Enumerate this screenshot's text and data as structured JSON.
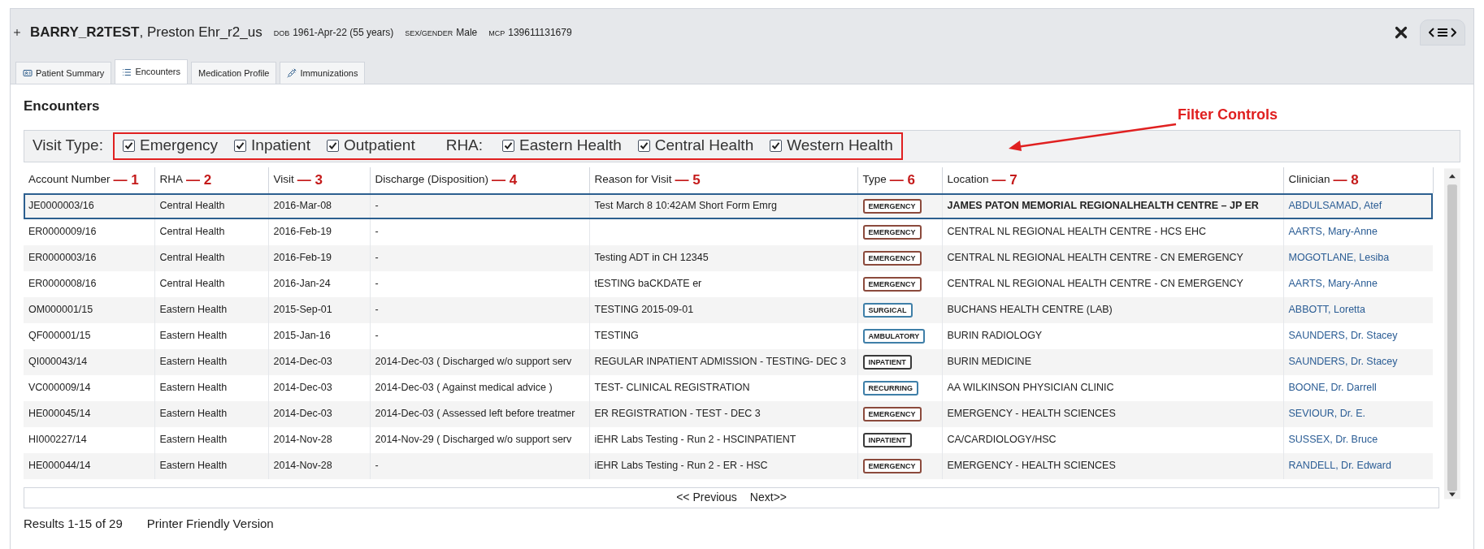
{
  "patient": {
    "name": "BARRY_R2TEST",
    "given": ", Preston Ehr_r2_us",
    "fields": [
      {
        "label": "DOB",
        "value": "1961-Apr-22 (55 years)"
      },
      {
        "label": "SEX/GENDER",
        "value": "Male"
      },
      {
        "label": "MCP",
        "value": "139611131679"
      }
    ]
  },
  "tabs": [
    {
      "label": "Patient Summary",
      "kind": "summary",
      "selected": false
    },
    {
      "label": "Encounters",
      "kind": "list",
      "selected": true
    },
    {
      "label": "Medication Profile",
      "kind": "none",
      "selected": false
    },
    {
      "label": "Immunizations",
      "kind": "syringe",
      "selected": false
    }
  ],
  "section_title": "Encounters",
  "filters": {
    "visit_type_label": "Visit Type:",
    "visit_types": [
      {
        "label": "Emergency",
        "checked": true
      },
      {
        "label": "Inpatient",
        "checked": true
      },
      {
        "label": "Outpatient",
        "checked": true
      }
    ],
    "rha_label": "RHA:",
    "rhas": [
      {
        "label": "Eastern Health",
        "checked": true
      },
      {
        "label": "Central Health",
        "checked": true
      },
      {
        "label": "Western Health",
        "checked": true
      }
    ]
  },
  "annotation": {
    "label": "Filter Controls"
  },
  "table": {
    "columns": [
      {
        "label": "Account Number",
        "marker": "— 1"
      },
      {
        "label": "RHA",
        "marker": "— 2"
      },
      {
        "label": "Visit",
        "marker": "— 3"
      },
      {
        "label": "Discharge (Disposition)",
        "marker": "— 4"
      },
      {
        "label": "Reason for Visit",
        "marker": "— 5"
      },
      {
        "label": "Type",
        "marker": "— 6"
      },
      {
        "label": "Location",
        "marker": "— 7"
      },
      {
        "label": "Clinician",
        "marker": "— 8"
      }
    ],
    "rows": [
      {
        "selected": true,
        "cells": [
          "JE0000003/16",
          "Central Health",
          "2016-Mar-08",
          "-",
          "Test March 8 10:42AM Short Form Emrg"
        ],
        "type": {
          "label": "EMERGENCY",
          "color": "#8b4a3c"
        },
        "location": "JAMES PATON MEMORIAL REGIONALHEALTH CENTRE – JP ER",
        "clinician": "ABDULSAMAD, Atef"
      },
      {
        "selected": false,
        "cells": [
          "ER0000009/16",
          "Central Health",
          "2016-Feb-19",
          "-",
          ""
        ],
        "type": {
          "label": "EMERGENCY",
          "color": "#8b4a3c"
        },
        "location": "CENTRAL NL REGIONAL HEALTH CENTRE - HCS EHC",
        "clinician": "AARTS, Mary-Anne"
      },
      {
        "selected": false,
        "cells": [
          "ER0000003/16",
          "Central Health",
          "2016-Feb-19",
          "-",
          "Testing ADT in CH 12345"
        ],
        "type": {
          "label": "EMERGENCY",
          "color": "#8b4a3c"
        },
        "location": "CENTRAL NL REGIONAL HEALTH CENTRE - CN EMERGENCY",
        "clinician": "MOGOTLANE, Lesiba"
      },
      {
        "selected": false,
        "cells": [
          "ER0000008/16",
          "Central Health",
          "2016-Jan-24",
          "-",
          "tESTING baCKDATE er"
        ],
        "type": {
          "label": "EMERGENCY",
          "color": "#8b4a3c"
        },
        "location": "CENTRAL NL REGIONAL HEALTH CENTRE - CN EMERGENCY",
        "clinician": "AARTS, Mary-Anne"
      },
      {
        "selected": false,
        "cells": [
          "OM000001/15",
          "Eastern Health",
          "2015-Sep-01",
          "-",
          "TESTING 2015-09-01"
        ],
        "type": {
          "label": "SURGICAL",
          "color": "#3f7fa8"
        },
        "location": "BUCHANS HEALTH CENTRE (LAB)",
        "clinician": "ABBOTT, Loretta"
      },
      {
        "selected": false,
        "cells": [
          "QF000001/15",
          "Eastern Health",
          "2015-Jan-16",
          "-",
          "TESTING"
        ],
        "type": {
          "label": "AMBULATORY",
          "color": "#3f7fa8"
        },
        "location": "BURIN RADIOLOGY",
        "clinician": "SAUNDERS, Dr. Stacey"
      },
      {
        "selected": false,
        "cells": [
          "QI000043/14",
          "Eastern Health",
          "2014-Dec-03",
          "2014-Dec-03 ( Discharged w/o support serv",
          "REGULAR INPATIENT ADMISSION - TESTING- DEC 3"
        ],
        "type": {
          "label": "INPATIENT",
          "color": "#3a3a3a"
        },
        "location": "BURIN MEDICINE",
        "clinician": "SAUNDERS, Dr. Stacey"
      },
      {
        "selected": false,
        "cells": [
          "VC000009/14",
          "Eastern Health",
          "2014-Dec-03",
          "2014-Dec-03 ( Against medical advice )",
          "TEST- CLINICAL REGISTRATION"
        ],
        "type": {
          "label": "RECURRING",
          "color": "#3f7fa8"
        },
        "location": "AA WILKINSON PHYSICIAN CLINIC",
        "clinician": "BOONE, Dr. Darrell"
      },
      {
        "selected": false,
        "cells": [
          "HE000045/14",
          "Eastern Health",
          "2014-Dec-03",
          "2014-Dec-03 ( Assessed left before treatmer",
          "ER REGISTRATION - TEST - DEC 3"
        ],
        "type": {
          "label": "EMERGENCY",
          "color": "#8b4a3c"
        },
        "location": "EMERGENCY - HEALTH SCIENCES",
        "clinician": "SEVIOUR, Dr. E."
      },
      {
        "selected": false,
        "cells": [
          "HI000227/14",
          "Eastern Health",
          "2014-Nov-28",
          "2014-Nov-29 ( Discharged w/o support serv",
          "iEHR Labs Testing - Run 2 - HSCINPATIENT"
        ],
        "type": {
          "label": "INPATIENT",
          "color": "#3a3a3a"
        },
        "location": "CA/CARDIOLOGY/HSC",
        "clinician": "SUSSEX, Dr. Bruce"
      },
      {
        "selected": false,
        "cells": [
          "HE000044/14",
          "Eastern Health",
          "2014-Nov-28",
          "-",
          "iEHR Labs Testing - Run 2 - ER - HSC"
        ],
        "type": {
          "label": "EMERGENCY",
          "color": "#8b4a3c"
        },
        "location": "EMERGENCY - HEALTH SCIENCES",
        "clinician": "RANDELL, Dr. Edward"
      }
    ]
  },
  "pagination": {
    "previous": "<< Previous",
    "next": "Next>>"
  },
  "footer": {
    "results": "Results 1-15 of 29",
    "printer": "Printer Friendly Version"
  }
}
